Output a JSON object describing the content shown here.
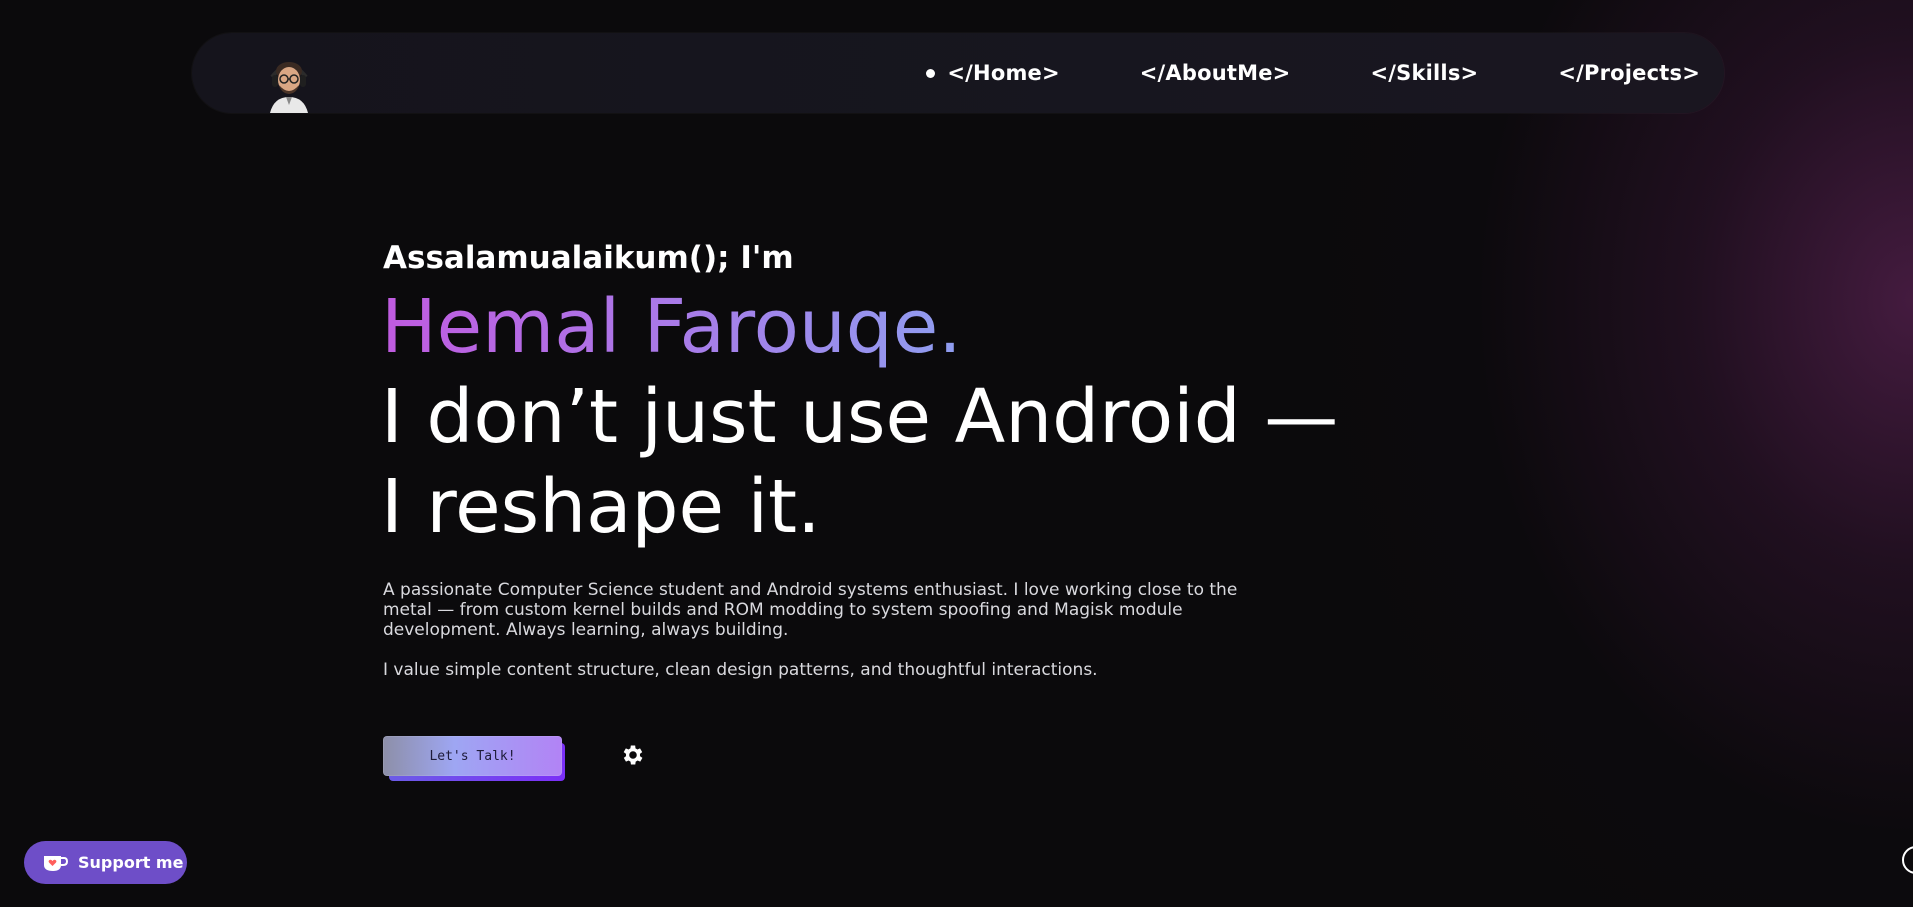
{
  "nav": {
    "avatar_icon": "avatar-icon",
    "items": [
      {
        "label": "</Home>",
        "active": true
      },
      {
        "label": "</AboutMe>",
        "active": false
      },
      {
        "label": "</Skills>",
        "active": false
      },
      {
        "label": "</Projects>",
        "active": false
      }
    ]
  },
  "hero": {
    "greeting": "Assalamualaikum(); I'm",
    "name": "Hemal Farouqe.",
    "tagline": "I don’t just use Android — I reshape it.",
    "description": "A passionate Computer Science student and Android systems enthusiast. I love working close to the metal — from custom kernel builds and ROM modding to system spoofing and Magisk module development. Always learning, always building.",
    "description2": "I value simple content structure, clean design patterns, and thoughtful interactions."
  },
  "cta": {
    "label": "Let's Talk!",
    "settings_icon": "gear-icon"
  },
  "support": {
    "label": "Support me",
    "icon": "coffee-cup-icon"
  },
  "colors": {
    "background": "#0b0a0c",
    "name_gradient_start": "#c05be0",
    "name_gradient_end": "#8f9ef0",
    "support_bg": "#6e4ec8",
    "cta_shadow": "#7b2ff7"
  }
}
